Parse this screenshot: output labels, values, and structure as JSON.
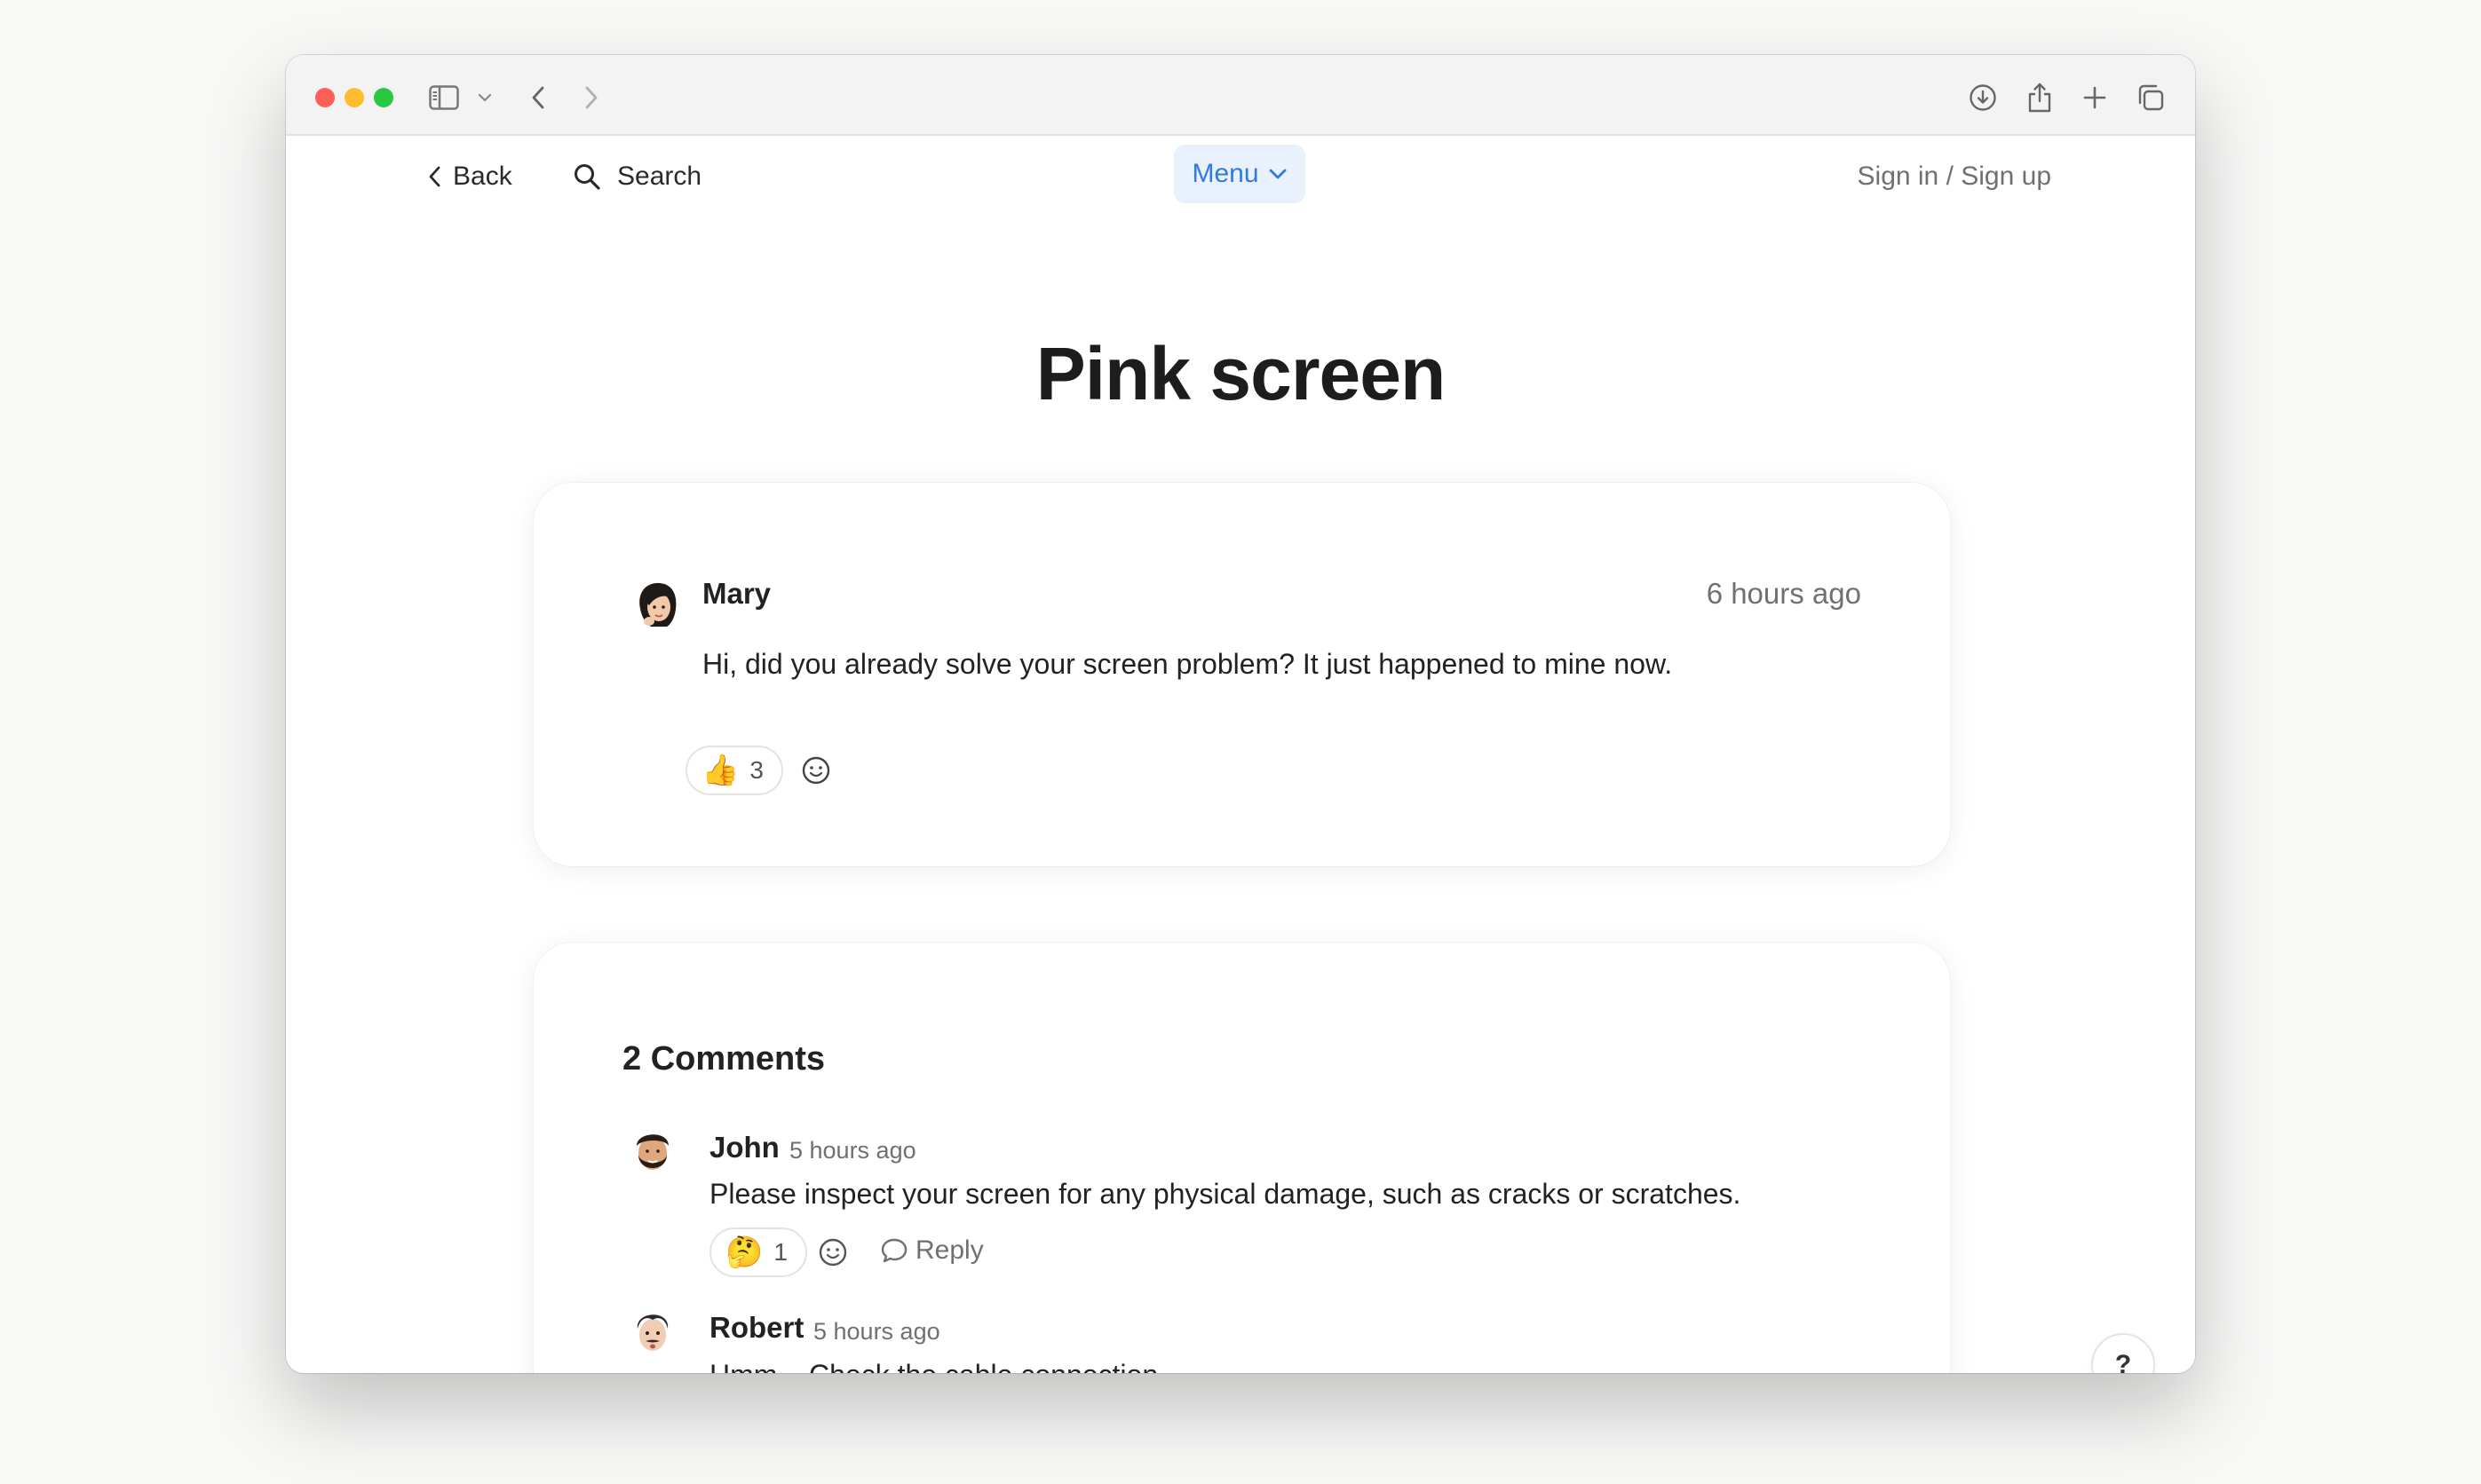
{
  "nav": {
    "back_label": "Back",
    "search_label": "Search",
    "menu_label": "Menu",
    "signin_label": "Sign in / Sign up"
  },
  "page": {
    "title": "Pink screen"
  },
  "post": {
    "author": "Mary",
    "time": "6 hours ago",
    "body": "Hi, did you already solve your screen problem? It just happened to mine now.",
    "reaction_emoji": "👍",
    "reaction_count": "3"
  },
  "comments": {
    "title": "2 Comments",
    "reply_label": "Reply",
    "items": [
      {
        "author": "John",
        "time": "5 hours ago",
        "body": "Please inspect your screen for any physical damage, such as cracks or scratches.",
        "reaction_emoji": "🤔",
        "reaction_count": "1"
      },
      {
        "author": "Robert",
        "time": "5 hours ago",
        "body": "Hmm... Check the cable connection"
      }
    ]
  },
  "help": {
    "label": "?"
  },
  "colors": {
    "accent": "#2f7ae5",
    "menu_bg": "#e9f1fd"
  }
}
